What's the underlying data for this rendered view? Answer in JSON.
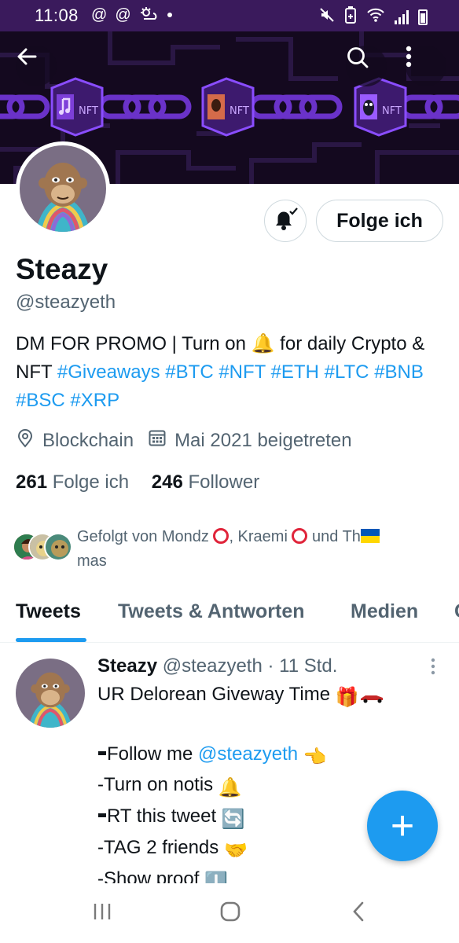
{
  "status_bar": {
    "time": "11:08",
    "left_icons": [
      "at-icon",
      "at-icon",
      "weather-icon",
      "dot-icon"
    ],
    "right_icons": [
      "mute-icon",
      "battery-saver-icon",
      "wifi-icon",
      "signal-icon",
      "battery-icon"
    ]
  },
  "banner": {
    "colors": {
      "background": "#14091f",
      "chain": "#7b3fe4"
    },
    "cube_labels": [
      "NFT",
      "NFT",
      "NFT"
    ]
  },
  "header_buttons": {
    "back": "back-arrow-icon",
    "search": "search-icon",
    "more": "more-vert-icon"
  },
  "profile": {
    "name": "Steazy",
    "handle": "@steazyeth",
    "follow_button_label": "Folge ich",
    "bio": {
      "part1": "DM FOR PROMO | Turn on ",
      "bell": "🔔",
      "part2": " for daily Crypto & NFT ",
      "hashtags": [
        "#Giveaways",
        "#BTC",
        "#NFT",
        "#ETH",
        "#LTC",
        "#BNB",
        "#BSC",
        "#XRP"
      ]
    },
    "location": "Blockchain",
    "joined": "Mai 2021 beigetreten",
    "following_count": "261",
    "following_label": "Folge ich",
    "followers_count": "246",
    "followers_label": "Follower",
    "followed_by": {
      "prefix": "Gefolgt von Mondz ",
      "mid": ", Kraemi ",
      "suffix_a": " und Th",
      "suffix_b": "mas"
    }
  },
  "tabs": [
    {
      "label": "Tweets",
      "active": true
    },
    {
      "label": "Tweets & Antworten",
      "active": false
    },
    {
      "label": "Medien",
      "active": false
    },
    {
      "label": "G",
      "active": false
    }
  ],
  "tweet": {
    "author": "Steazy",
    "handle": "@steazyeth",
    "separator": "·",
    "time": "11 Std.",
    "line1": "UR Delorean Giveway Time ",
    "line1_emoji": "🎁",
    "line2_a": "Follow me ",
    "line2_mention": "@steazyeth",
    "line2_emoji": "👈",
    "line3": "-Turn on notis ",
    "line3_emoji": "🔔",
    "line4": "RT this tweet ",
    "line4_emoji": "🔄",
    "line5": "-TAG 2 friends ",
    "line5_emoji": "🤝",
    "line6": "-Show proof ",
    "line6_emoji": "⬇️"
  },
  "fab": {
    "label": "+"
  },
  "colors": {
    "accent": "#1d9bf0",
    "status_bar": "#3a1a5c"
  }
}
